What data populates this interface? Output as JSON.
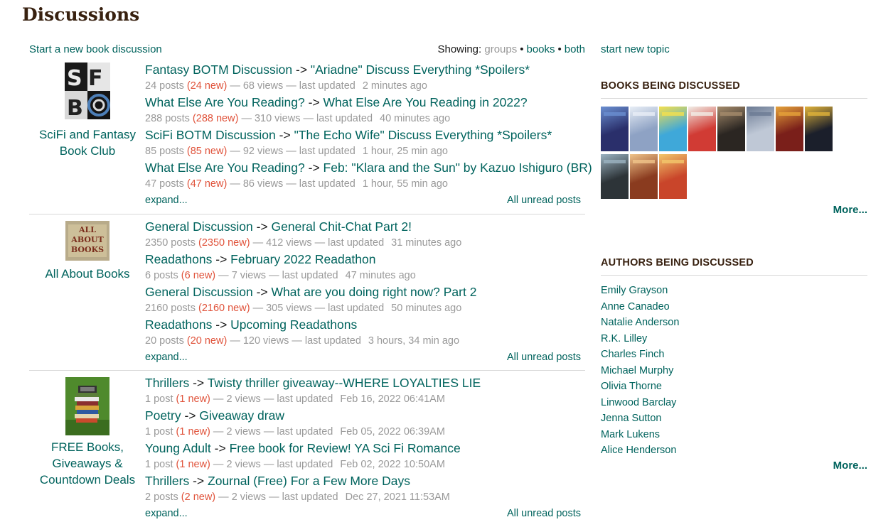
{
  "page": {
    "title": "Discussions"
  },
  "header": {
    "start_link": "Start a new book discussion",
    "showing_label": "Showing:",
    "showing_options": [
      "groups",
      "books",
      "both"
    ]
  },
  "groups": [
    {
      "name": "SciFi and Fantasy Book Club",
      "expand": "expand...",
      "unread": "All unread posts",
      "topics": [
        {
          "folder": "Fantasy BOTM Discussion",
          "title": "\"Ariadne\" Discuss Everything *Spoilers*",
          "posts": "24 posts",
          "new": "(24 new)",
          "views": "— 68 views — last updated",
          "time": "2 minutes ago"
        },
        {
          "folder": "What Else Are You Reading?",
          "title": "What Else Are You Reading in 2022?",
          "posts": "288 posts",
          "new": "(288 new)",
          "views": "— 310 views — last updated",
          "time": "40 minutes ago"
        },
        {
          "folder": "SciFi BOTM Discussion",
          "title": "\"The Echo Wife\" Discuss Everything *Spoilers*",
          "posts": "85 posts",
          "new": "(85 new)",
          "views": "— 92 views — last updated",
          "time": "1 hour, 25 min ago"
        },
        {
          "folder": "What Else Are You Reading?",
          "title": "Feb: \"Klara and the Sun\" by Kazuo Ishiguro (BR)",
          "posts": "47 posts",
          "new": "(47 new)",
          "views": "— 86 views — last updated",
          "time": "1 hour, 55 min ago"
        }
      ]
    },
    {
      "name": "All About Books",
      "expand": "expand...",
      "unread": "All unread posts",
      "topics": [
        {
          "folder": "General Discussion",
          "title": "General Chit-Chat Part 2!",
          "posts": "2350 posts",
          "new": "(2350 new)",
          "views": "— 412 views — last updated",
          "time": "31 minutes ago"
        },
        {
          "folder": "Readathons",
          "title": "February 2022 Readathon",
          "posts": "6 posts",
          "new": "(6 new)",
          "views": "— 7 views — last updated",
          "time": "47 minutes ago"
        },
        {
          "folder": "General Discussion",
          "title": "What are you doing right now? Part 2",
          "posts": "2160 posts",
          "new": "(2160 new)",
          "views": "— 305 views — last updated",
          "time": "50 minutes ago"
        },
        {
          "folder": "Readathons",
          "title": "Upcoming Readathons",
          "posts": "20 posts",
          "new": "(20 new)",
          "views": "— 120 views — last updated",
          "time": "3 hours, 34 min ago"
        }
      ]
    },
    {
      "name": "FREE Books, Giveaways & Countdown Deals",
      "expand": "expand...",
      "unread": "All unread posts",
      "topics": [
        {
          "folder": "Thrillers",
          "title": "Twisty thriller giveaway--WHERE LOYALTIES LIE",
          "posts": "1 post",
          "new": "(1 new)",
          "views": "— 2 views — last updated",
          "time": "Feb 16, 2022 06:41AM"
        },
        {
          "folder": "Poetry",
          "title": "Giveaway draw",
          "posts": "1 post",
          "new": "(1 new)",
          "views": "— 2 views — last updated",
          "time": "Feb 05, 2022 06:39AM"
        },
        {
          "folder": "Young Adult",
          "title": "Free book for Review! YA Sci Fi Romance",
          "posts": "1 post",
          "new": "(1 new)",
          "views": "— 2 views — last updated",
          "time": "Feb 02, 2022 10:50AM"
        },
        {
          "folder": "Thrillers",
          "title": "Zournal (Free) For a Few More Days",
          "posts": "2 posts",
          "new": "(2 new)",
          "views": "— 2 views — last updated",
          "time": "Dec 27, 2021 11:53AM"
        }
      ]
    }
  ],
  "sidebar": {
    "new_topic": "start new topic",
    "books_heading": "BOOKS BEING DISCUSSED",
    "book_covers": [
      {
        "color": "#2a2f6b",
        "accent": "#6a8fd1"
      },
      {
        "color": "#8ea2c4",
        "accent": "#e8eef6"
      },
      {
        "color": "#3fa8d9",
        "accent": "#f4e04d"
      },
      {
        "color": "#d13b34",
        "accent": "#f1ede6"
      },
      {
        "color": "#2b2622",
        "accent": "#a58b6b"
      },
      {
        "color": "#bfc8d6",
        "accent": "#6b7a93"
      },
      {
        "color": "#7a1f1a",
        "accent": "#e6a23a"
      },
      {
        "color": "#1b1f2b",
        "accent": "#e0b33a"
      },
      {
        "color": "#2d3438",
        "accent": "#9bb3c1"
      },
      {
        "color": "#8a3b1f",
        "accent": "#f0c48a"
      },
      {
        "color": "#c9452a",
        "accent": "#f2c76b"
      }
    ],
    "books_more": "More...",
    "authors_heading": "AUTHORS BEING DISCUSSED",
    "authors": [
      "Emily Grayson",
      "Anne Canadeo",
      "Natalie Anderson",
      "R.K. Lilley",
      "Charles Finch",
      "Michael Murphy",
      "Olivia Thorne",
      "Linwood Barclay",
      "Jenna Sutton",
      "Mark Lukens",
      "Alice Henderson"
    ],
    "authors_more": "More..."
  }
}
